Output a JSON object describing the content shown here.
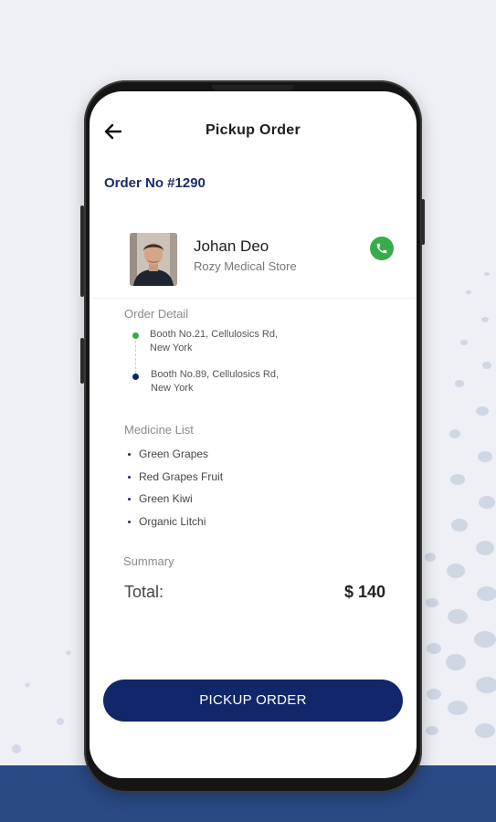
{
  "header": {
    "title": "Pickup Order",
    "back_icon": "arrow-left-icon"
  },
  "order": {
    "number_label": "Order No #1290"
  },
  "customer": {
    "name": "Johan Deo",
    "store": "Rozy Medical Store",
    "call_icon": "phone-icon",
    "call_color": "#38ab4a"
  },
  "order_detail": {
    "label": "Order Detail",
    "pickup_address": [
      "Booth No.21, Cellulosics Rd,",
      "New York"
    ],
    "drop_address": [
      "Booth No.89, Cellulosics Rd,",
      "New York"
    ],
    "pickup_dot_color": "#38ab4a",
    "drop_dot_color": "#12266a"
  },
  "medicine_list": {
    "label": "Medicine List",
    "items": [
      "Green Grapes",
      "Red Grapes Fruit",
      "Green Kiwi",
      "Organic Litchi"
    ]
  },
  "summary": {
    "label": "Summary",
    "total_label": "Total:",
    "total_value": "$ 140"
  },
  "action": {
    "pickup_button_label": "PICKUP ORDER"
  },
  "colors": {
    "primary": "#12266a",
    "background": "#eef0f5",
    "band": "#2a4a86"
  }
}
